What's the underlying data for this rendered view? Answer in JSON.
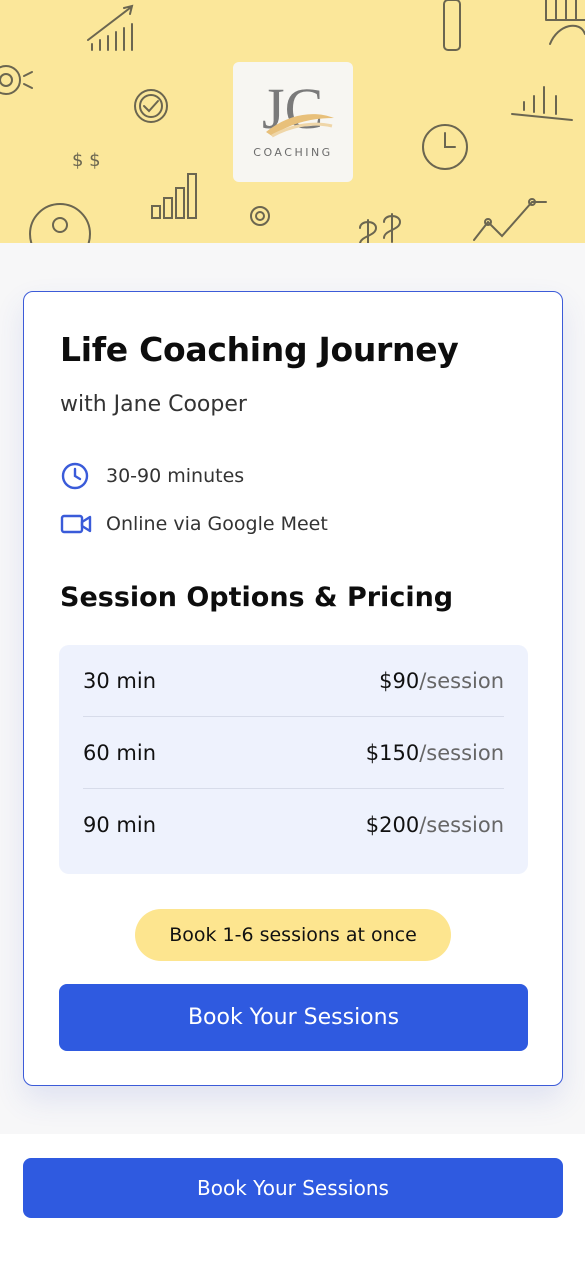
{
  "brand": {
    "logo_initials": "JC",
    "logo_subtitle": "COACHING",
    "banner_color": "#fbe79a",
    "doodle_text": "$ $"
  },
  "offer": {
    "title": "Life Coaching Journey",
    "coach": "with Jane Cooper",
    "duration_icon": "clock-icon",
    "duration": "30-90 minutes",
    "location_icon": "video-camera-icon",
    "location": "Online via Google Meet"
  },
  "pricing": {
    "heading": "Session Options & Pricing",
    "rows": [
      {
        "duration": "30 min",
        "price": "$90",
        "unit": "/session"
      },
      {
        "duration": "60 min",
        "price": "$150",
        "unit": "/session"
      },
      {
        "duration": "90 min",
        "price": "$200",
        "unit": "/session"
      }
    ]
  },
  "badge": {
    "text": "Book 1-6 sessions at once",
    "color": "#fde58f"
  },
  "cta": {
    "label": "Book Your Sessions",
    "color": "#2f5ae0"
  },
  "footer": {
    "cta_label": "Book Your Sessions"
  }
}
